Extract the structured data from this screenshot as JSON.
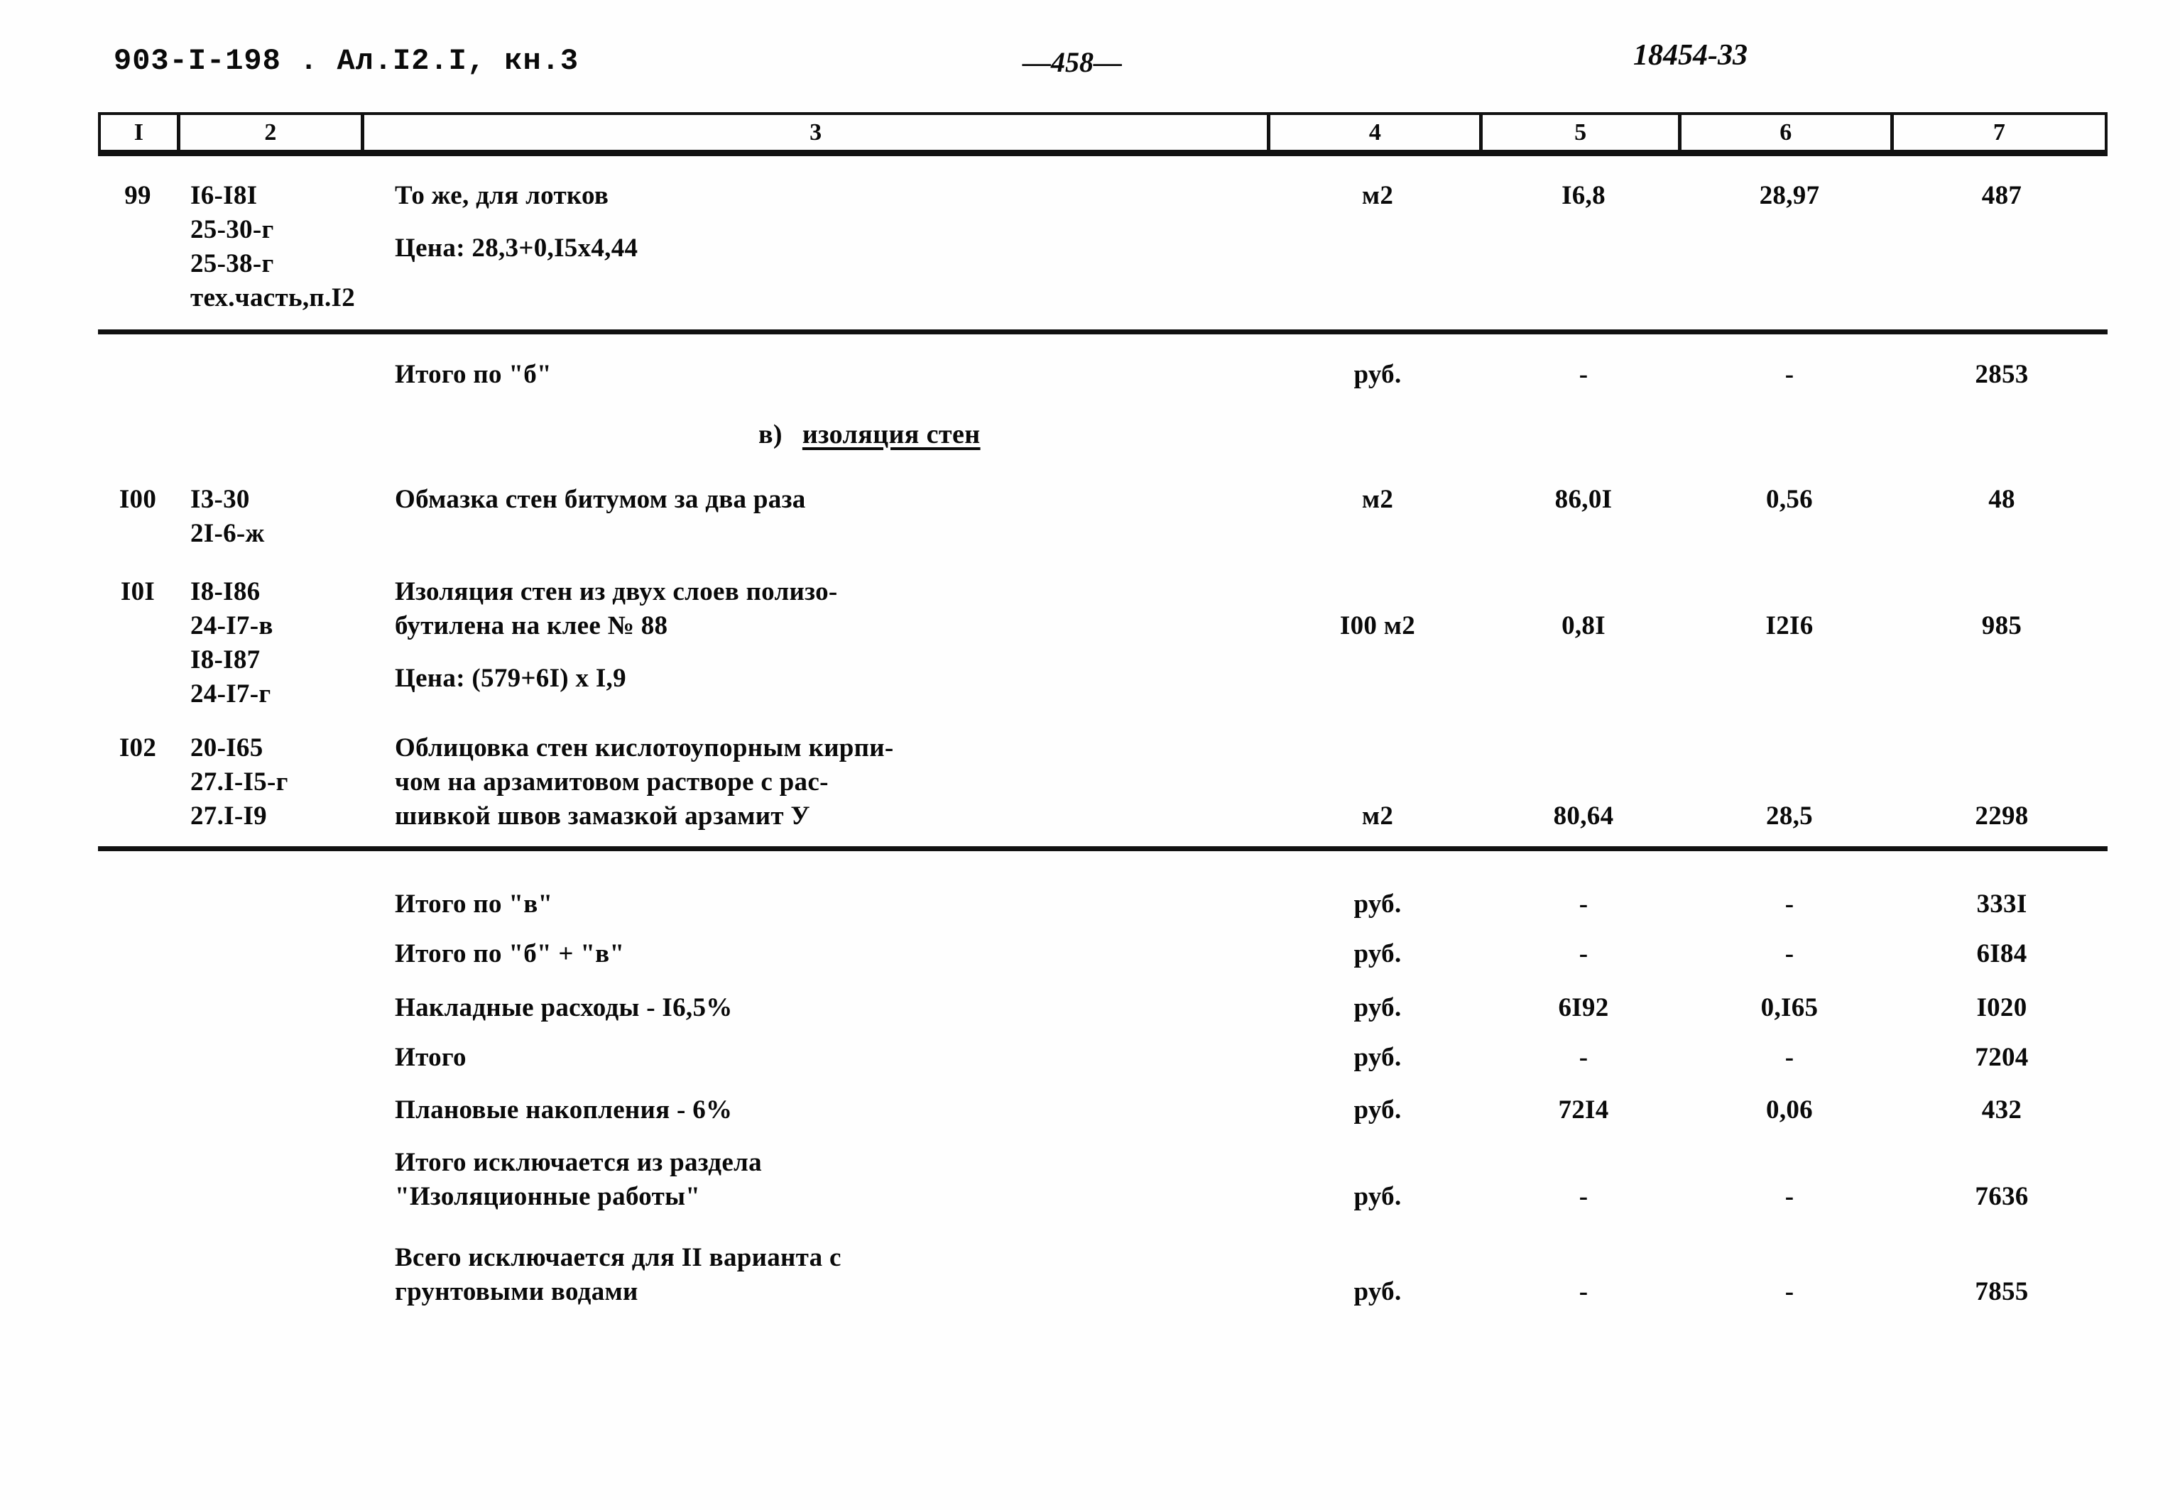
{
  "header": {
    "doc_code": "903-I-198 . Ал.I2.I, кн.3",
    "page_number": "—458—",
    "sheet_number": "18454-33"
  },
  "table": {
    "column_headers": [
      "I",
      "2",
      "3",
      "4",
      "5",
      "6",
      "7"
    ],
    "rows": [
      {
        "num": "99",
        "codes": [
          "I6-I8I",
          "25-30-г",
          "25-38-г",
          "тех.часть,п.I2"
        ],
        "desc": [
          "То же, для лотков",
          "Цена: 28,3+0,I5x4,44"
        ],
        "unit": "м2",
        "v5": "I6,8",
        "v6": "28,97",
        "v7": "487"
      },
      {
        "num": "",
        "codes": [],
        "desc": [
          "Итого по \"б\""
        ],
        "unit": "руб.",
        "v5": "-",
        "v6": "-",
        "v7": "2853"
      },
      {
        "num": "I00",
        "codes": [
          "I3-30",
          "2I-6-ж"
        ],
        "desc": [
          "Обмазка стен битумом за два раза"
        ],
        "unit": "м2",
        "v5": "86,0I",
        "v6": "0,56",
        "v7": "48"
      },
      {
        "num": "I0I",
        "codes": [
          "I8-I86",
          "24-I7-в",
          "I8-I87",
          "24-I7-г"
        ],
        "desc": [
          "Изоляция стен из двух слоев полизо-",
          "бутилена на клее № 88",
          "",
          "Цена: (579+6I)  x I,9"
        ],
        "unit": "I00 м2",
        "v5": "0,8I",
        "v6": "I2I6",
        "v7": "985"
      },
      {
        "num": "I02",
        "codes": [
          "20-I65",
          "27.I-I5-г",
          "27.I-I9"
        ],
        "desc": [
          "Облицовка стен кислотоупорным кирпи-",
          "чом на арзамитовом растворе с рас-",
          "шивкой швов замазкой арзамит У"
        ],
        "unit": "м2",
        "v5": "80,64",
        "v6": "28,5",
        "v7": "2298"
      },
      {
        "num": "",
        "codes": [],
        "desc": [
          "Итого по \"в\""
        ],
        "unit": "руб.",
        "v5": "-",
        "v6": "-",
        "v7": "333I"
      },
      {
        "num": "",
        "codes": [],
        "desc": [
          "Итого по \"б\" + \"в\""
        ],
        "unit": "руб.",
        "v5": "-",
        "v6": "-",
        "v7": "6I84"
      },
      {
        "num": "",
        "codes": [],
        "desc": [
          "Накладные расходы - I6,5%"
        ],
        "unit": "руб.",
        "v5": "6I92",
        "v6": "0,I65",
        "v7": "I020"
      },
      {
        "num": "",
        "codes": [],
        "desc": [
          "Итого"
        ],
        "unit": "руб.",
        "v5": "-",
        "v6": "-",
        "v7": "7204"
      },
      {
        "num": "",
        "codes": [],
        "desc": [
          "Плановые накопления - 6%"
        ],
        "unit": "руб.",
        "v5": "72I4",
        "v6": "0,06",
        "v7": "432"
      },
      {
        "num": "",
        "codes": [],
        "desc": [
          "Итого исключается из раздела",
          "\"Изоляционные работы\""
        ],
        "unit": "руб.",
        "v5": "-",
        "v6": "-",
        "v7": "7636"
      },
      {
        "num": "",
        "codes": [],
        "desc": [
          "Всего исключается для II варианта с",
          "грунтовыми водами"
        ],
        "unit": "руб.",
        "v5": "-",
        "v6": "-",
        "v7": "7855"
      }
    ]
  },
  "section_heading": {
    "prefix": "в)",
    "title": "изоляция стен"
  }
}
